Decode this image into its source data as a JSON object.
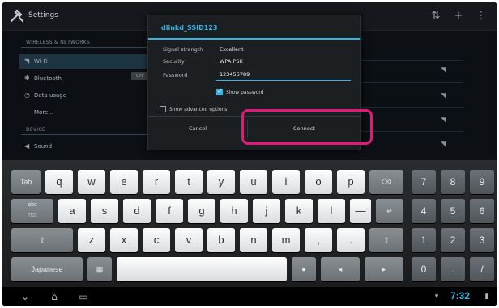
{
  "actionbar": {
    "title": "Settings",
    "icons": [
      "usb-icon",
      "add-icon",
      "overflow-menu-icon"
    ]
  },
  "settings_list": {
    "section_wireless": "WIRELESS & NETWORKS",
    "items": [
      {
        "label": "Wi-Fi",
        "icon": "wifi-icon",
        "selected": true
      },
      {
        "label": "Bluetooth",
        "icon": "bluetooth-icon",
        "toggle": "OFF"
      },
      {
        "label": "Data usage",
        "icon": "data-usage-icon"
      },
      {
        "label": "More...",
        "icon": ""
      }
    ],
    "section_device": "DEVICE",
    "device_item": "Sound"
  },
  "dialog": {
    "title": "dlinkd_SSID123",
    "rows": [
      {
        "label": "Signal strength",
        "value": "Excellent"
      },
      {
        "label": "Security",
        "value": "WPA PSK"
      }
    ],
    "password_label": "Password",
    "password_value": "123456789",
    "show_password": "Show password",
    "show_advanced": "Show advanced options",
    "cancel": "Cancel",
    "connect": "Connect"
  },
  "keyboard": {
    "row1": [
      "q",
      "w",
      "e",
      "r",
      "t",
      "y",
      "u",
      "i",
      "o",
      "p"
    ],
    "row2": [
      "a",
      "s",
      "d",
      "f",
      "g",
      "h",
      "j",
      "k",
      "l",
      "—"
    ],
    "row3": [
      "z",
      "x",
      "c",
      "v",
      "b",
      "n",
      "m",
      ",",
      "."
    ],
    "tab": "Tab",
    "abc": "abc",
    "abc_sub": "?123",
    "lang": "Japanese",
    "numpad": [
      "7",
      "8",
      "9",
      "4",
      "5",
      "6",
      "1",
      "2",
      "3",
      "0",
      ".",
      "/"
    ]
  },
  "statusbar": {
    "time": "7:32"
  },
  "colors": {
    "accent": "#33b5e5",
    "highlight": "#e0197a"
  }
}
